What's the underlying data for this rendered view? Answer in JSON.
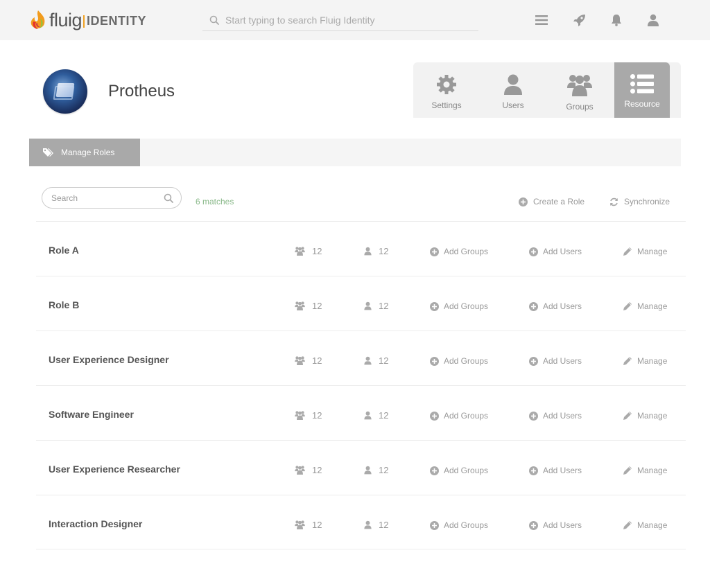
{
  "brand": {
    "word": "fluig",
    "product": "IDENTITY"
  },
  "top_search": {
    "placeholder": "Start typing to search Fluig Identity"
  },
  "top_icons": [
    "menu-icon",
    "rocket-icon",
    "bell-icon",
    "user-icon"
  ],
  "app": {
    "name": "Protheus"
  },
  "nav_tabs": [
    {
      "label": "Settings",
      "icon": "gear-icon",
      "active": false
    },
    {
      "label": "Users",
      "icon": "user-icon",
      "active": false
    },
    {
      "label": "Groups",
      "icon": "groups-icon",
      "active": false
    },
    {
      "label": "Resource",
      "icon": "list-icon",
      "active": true
    }
  ],
  "subbar": {
    "tab_label": "Manage Roles",
    "icon": "tag-icon"
  },
  "toolbar": {
    "search_placeholder": "Search",
    "matches": "6 matches",
    "create_label": "Create a Role",
    "sync_label": "Synchronize"
  },
  "row_actions": {
    "add_groups": "Add Groups",
    "add_users": "Add Users",
    "manage": "Manage"
  },
  "roles": [
    {
      "name": "Role A",
      "groups": "12",
      "users": "12"
    },
    {
      "name": "Role B",
      "groups": "12",
      "users": "12"
    },
    {
      "name": "User Experience Designer",
      "groups": "12",
      "users": "12"
    },
    {
      "name": "Software Engineer",
      "groups": "12",
      "users": "12"
    },
    {
      "name": "User Experience Researcher",
      "groups": "12",
      "users": "12"
    },
    {
      "name": "Interaction Designer",
      "groups": "12",
      "users": "12"
    }
  ],
  "colors": {
    "accent_gray": "#a9a9a9",
    "matches_green": "#8ab98a",
    "topbar": "#f4f4f4"
  }
}
